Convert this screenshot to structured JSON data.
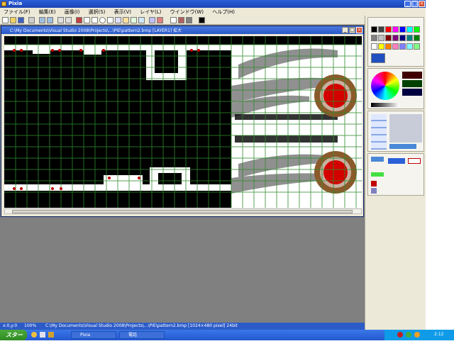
{
  "window": {
    "title": "Pixia"
  },
  "menu": [
    "ファイル(F)",
    "編集(E)",
    "画像(I)",
    "選択(S)",
    "表示(V)",
    "レイヤ(L)",
    "ウインドウ(W)",
    "ヘルプ(H)"
  ],
  "document": {
    "title": "C:\\My Documents\\Visual Studio 2008\\Projects\\...\\PIE\\pattern2.bmp  [LAYER1] 拡大"
  },
  "status": {
    "coords": "x:0,y:0",
    "zoom": "100%",
    "path": "C:\\My Documents\\Visual Studio 2008\\Projects\\...\\PIE\\pattern2.bmp [1024×480 pixel] 24bit"
  },
  "taskbar": {
    "start_label": "スタート",
    "items": [
      "Pixia",
      "電話"
    ],
    "clock": "2:12"
  },
  "colors": {
    "titlebar": "#245edb",
    "canvas_bg": "#000000",
    "grid": "#2e8b2e",
    "brown_ring": "#8b5a2b",
    "red_core": "#d40000"
  }
}
